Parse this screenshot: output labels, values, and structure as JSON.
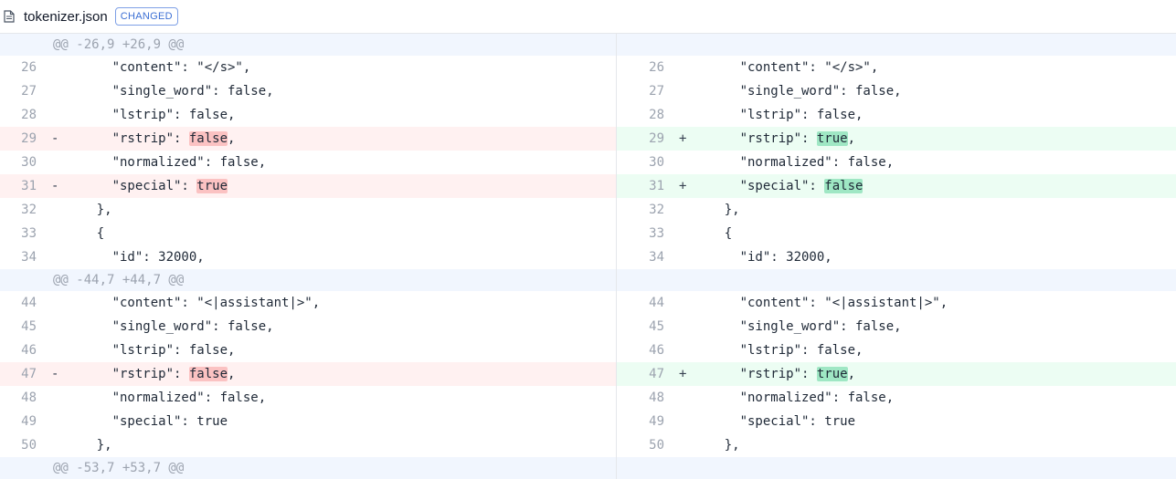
{
  "header": {
    "file_name": "tokenizer.json",
    "badge": "CHANGED",
    "icon": "file-icon"
  },
  "colors": {
    "deleted_row": "#fff1f1",
    "added_row": "#ecfdf3",
    "deleted_highlight": "#fbc2c2",
    "added_highlight": "#9fe7c4",
    "hunk_row": "#f1f6fe"
  },
  "diff": {
    "left": [
      {
        "type": "hunk",
        "text": "@@ -26,9 +26,9 @@"
      },
      {
        "type": "ctx",
        "ln": "26",
        "parts": [
          "      \"content\": \"</s>\","
        ]
      },
      {
        "type": "ctx",
        "ln": "27",
        "parts": [
          "      \"single_word\": false,"
        ]
      },
      {
        "type": "ctx",
        "ln": "28",
        "parts": [
          "      \"lstrip\": false,"
        ]
      },
      {
        "type": "del",
        "ln": "29",
        "marker": "-",
        "parts": [
          "      \"rstrip\": ",
          "false",
          ","
        ]
      },
      {
        "type": "ctx",
        "ln": "30",
        "parts": [
          "      \"normalized\": false,"
        ]
      },
      {
        "type": "del",
        "ln": "31",
        "marker": "-",
        "parts": [
          "      \"special\": ",
          "true",
          ""
        ]
      },
      {
        "type": "ctx",
        "ln": "32",
        "parts": [
          "    },"
        ]
      },
      {
        "type": "ctx",
        "ln": "33",
        "parts": [
          "    {"
        ]
      },
      {
        "type": "ctx",
        "ln": "34",
        "parts": [
          "      \"id\": 32000,"
        ]
      },
      {
        "type": "hunk",
        "text": "@@ -44,7 +44,7 @@"
      },
      {
        "type": "ctx",
        "ln": "44",
        "parts": [
          "      \"content\": \"<|assistant|>\","
        ]
      },
      {
        "type": "ctx",
        "ln": "45",
        "parts": [
          "      \"single_word\": false,"
        ]
      },
      {
        "type": "ctx",
        "ln": "46",
        "parts": [
          "      \"lstrip\": false,"
        ]
      },
      {
        "type": "del",
        "ln": "47",
        "marker": "-",
        "parts": [
          "      \"rstrip\": ",
          "false",
          ","
        ]
      },
      {
        "type": "ctx",
        "ln": "48",
        "parts": [
          "      \"normalized\": false,"
        ]
      },
      {
        "type": "ctx",
        "ln": "49",
        "parts": [
          "      \"special\": true"
        ]
      },
      {
        "type": "ctx",
        "ln": "50",
        "parts": [
          "    },"
        ]
      },
      {
        "type": "hunk",
        "text": "@@ -53,7 +53,7 @@"
      }
    ],
    "right": [
      {
        "type": "hunk",
        "text": ""
      },
      {
        "type": "ctx",
        "ln": "26",
        "parts": [
          "      \"content\": \"</s>\","
        ]
      },
      {
        "type": "ctx",
        "ln": "27",
        "parts": [
          "      \"single_word\": false,"
        ]
      },
      {
        "type": "ctx",
        "ln": "28",
        "parts": [
          "      \"lstrip\": false,"
        ]
      },
      {
        "type": "add",
        "ln": "29",
        "marker": "+",
        "parts": [
          "      \"rstrip\": ",
          "true",
          ","
        ]
      },
      {
        "type": "ctx",
        "ln": "30",
        "parts": [
          "      \"normalized\": false,"
        ]
      },
      {
        "type": "add",
        "ln": "31",
        "marker": "+",
        "parts": [
          "      \"special\": ",
          "false",
          ""
        ]
      },
      {
        "type": "ctx",
        "ln": "32",
        "parts": [
          "    },"
        ]
      },
      {
        "type": "ctx",
        "ln": "33",
        "parts": [
          "    {"
        ]
      },
      {
        "type": "ctx",
        "ln": "34",
        "parts": [
          "      \"id\": 32000,"
        ]
      },
      {
        "type": "hunk",
        "text": ""
      },
      {
        "type": "ctx",
        "ln": "44",
        "parts": [
          "      \"content\": \"<|assistant|>\","
        ]
      },
      {
        "type": "ctx",
        "ln": "45",
        "parts": [
          "      \"single_word\": false,"
        ]
      },
      {
        "type": "ctx",
        "ln": "46",
        "parts": [
          "      \"lstrip\": false,"
        ]
      },
      {
        "type": "add",
        "ln": "47",
        "marker": "+",
        "parts": [
          "      \"rstrip\": ",
          "true",
          ","
        ]
      },
      {
        "type": "ctx",
        "ln": "48",
        "parts": [
          "      \"normalized\": false,"
        ]
      },
      {
        "type": "ctx",
        "ln": "49",
        "parts": [
          "      \"special\": true"
        ]
      },
      {
        "type": "ctx",
        "ln": "50",
        "parts": [
          "    },"
        ]
      },
      {
        "type": "hunk",
        "text": ""
      }
    ]
  }
}
